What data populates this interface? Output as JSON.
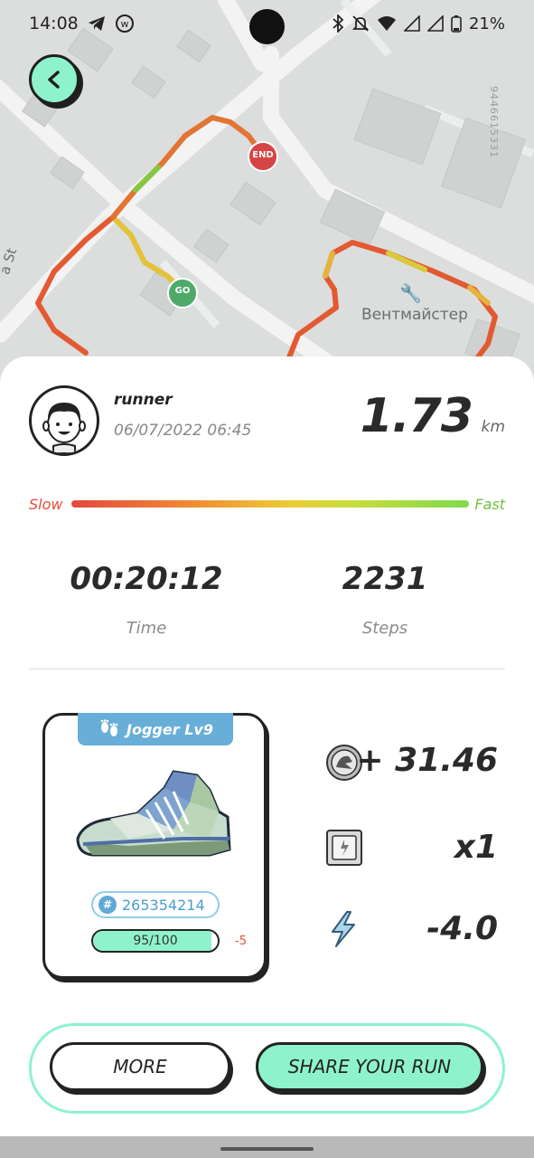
{
  "status_bar": {
    "time": "14:08",
    "battery": "21%"
  },
  "map": {
    "poi_label": "Вентмайстер",
    "street_label": "a St",
    "vertical_text": "9446615331",
    "start_marker": "GO",
    "end_marker": "END"
  },
  "run": {
    "username": "runner",
    "datetime": "06/07/2022 06:45",
    "distance": "1.73",
    "distance_unit": "km",
    "speed_slow_label": "Slow",
    "speed_fast_label": "Fast",
    "time_value": "00:20:12",
    "time_label": "Time",
    "steps_value": "2231",
    "steps_label": "Steps"
  },
  "shoe": {
    "tag_label": "Jogger Lv9",
    "id": "265354214",
    "id_hash": "#",
    "durability_text": "95/100",
    "durability_fraction": 0.95,
    "durability_delta": "-5"
  },
  "rewards": {
    "earned": "+ 31.46",
    "multiplier": "x1",
    "energy": "-4.0"
  },
  "buttons": {
    "more": "MORE",
    "share": "SHARE YOUR RUN"
  },
  "colors": {
    "accent": "#8ef3cd",
    "slow": "#e54b3c",
    "fast": "#6fc23e",
    "shoe_tag": "#67aed8"
  }
}
